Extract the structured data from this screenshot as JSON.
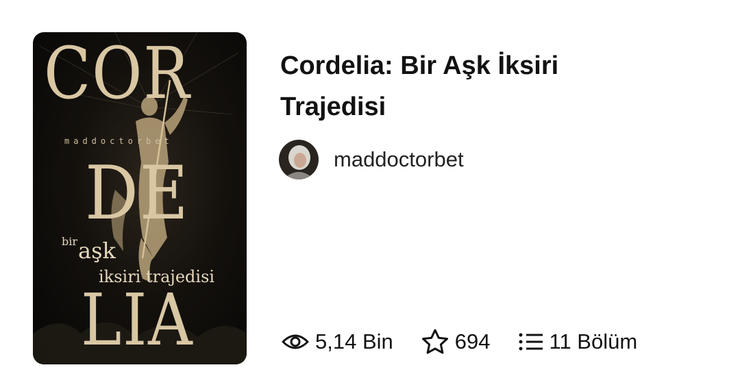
{
  "story": {
    "title": "Cordelia: Bir Aşk İksiri Trajedisi",
    "author": "maddoctorbet",
    "stats": {
      "reads": "5,14 Bin",
      "votes": "694",
      "parts": "11 Bölüm"
    }
  },
  "cover": {
    "word_top": "COR",
    "word_mid": "DE",
    "word_bottom": "LIA",
    "author_text": "maddoctorbet",
    "subtitle_1": "bir",
    "subtitle_2": "aşk",
    "subtitle_3": "iksiri trajedisi",
    "colors": {
      "background": "#14110d",
      "lettering": "#d9c7a4",
      "figure": "#b8a27a"
    }
  },
  "icons": {
    "reads": "eye-icon",
    "votes": "star-icon",
    "parts": "list-icon"
  }
}
